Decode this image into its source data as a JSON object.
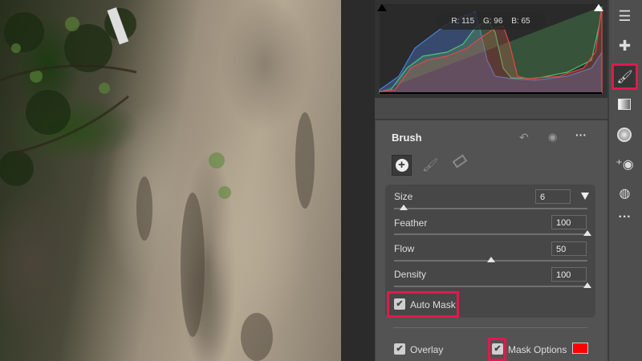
{
  "histogram": {
    "r_label": "R: 115",
    "g_label": "G: 96",
    "b_label": "B: 65"
  },
  "panel": {
    "title": "Brush",
    "header_icons": [
      "undo-icon",
      "eye-icon",
      "more-icon"
    ],
    "tools": [
      "add-brush-icon",
      "brush-icon",
      "eraser-icon"
    ],
    "sliders": [
      {
        "label": "Size",
        "value": "6",
        "fraction": 0.05
      },
      {
        "label": "Feather",
        "value": "100",
        "fraction": 1.0
      },
      {
        "label": "Flow",
        "value": "50",
        "fraction": 0.5
      },
      {
        "label": "Density",
        "value": "100",
        "fraction": 1.0
      }
    ],
    "auto_mask": {
      "label": "Auto Mask",
      "checked": true
    },
    "overlay": {
      "label": "Overlay",
      "checked": true
    },
    "mask_options": {
      "label": "Mask Options",
      "checked": true,
      "color": "#ff0000"
    }
  },
  "sidebar": {
    "tools": [
      "adjust-sliders-icon",
      "healing-icon",
      "brush-icon",
      "graduated-filter-icon",
      "radial-filter-icon",
      "red-eye-icon",
      "presets-icon",
      "more-icon"
    ],
    "active": "brush-icon"
  },
  "colors": {
    "highlight": "#e0194f"
  }
}
